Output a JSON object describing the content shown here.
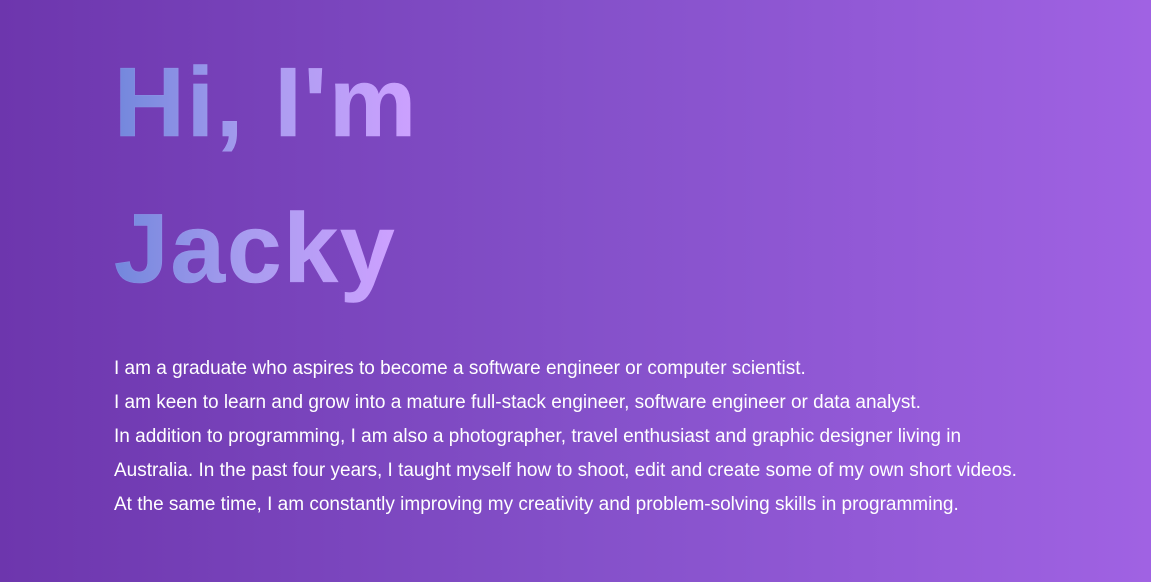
{
  "hero": {
    "title_line_1": "Hi, I'm",
    "title_line_2": "Jacky"
  },
  "bio": {
    "lines": [
      "I am a graduate who aspires to become a software engineer or computer scientist.",
      "I am keen to learn and grow into a mature full-stack engineer, software engineer or data analyst.",
      "In addition to programming, I am also a photographer, travel enthusiast and graphic designer living in",
      "Australia. In the past four years, I taught myself how to shoot, edit and create some of my own short videos.",
      "At the same time, I am constantly improving my creativity and problem-solving skills in programming."
    ]
  },
  "colors": {
    "background_start": "#6d36ad",
    "background_end": "#a062e3",
    "title_gradient_start": "#7287dc",
    "title_gradient_end": "#cda1ff",
    "bio_text": "#ffffff"
  }
}
